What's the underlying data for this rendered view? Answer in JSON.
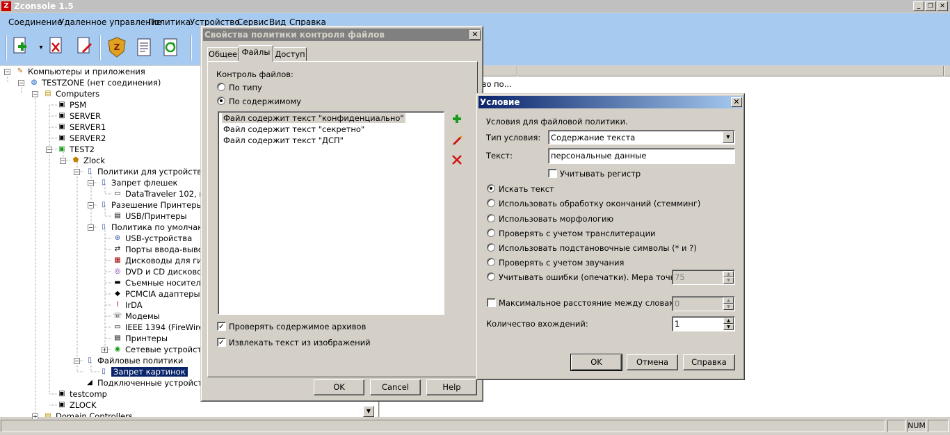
{
  "app": {
    "title": "Zconsole 1.5",
    "logo_letter": "Z"
  },
  "window_buttons": {
    "minimize": "_",
    "restore": "❐",
    "close": "✕"
  },
  "menu": [
    "Соединение",
    "Удаленное управление",
    "Политика",
    "Устройство",
    "Сервис",
    "Вид",
    "Справка"
  ],
  "tree": [
    {
      "label": "Компьютеры и приложения"
    },
    {
      "label": "TESTZONE (нет соединения)"
    },
    {
      "label": "Computers"
    },
    {
      "label": "PSM"
    },
    {
      "label": "SERVER"
    },
    {
      "label": "SERVER1"
    },
    {
      "label": "SERVER2"
    },
    {
      "label": "TEST2"
    },
    {
      "label": "Zlock"
    },
    {
      "label": "Политики для устройств"
    },
    {
      "label": "Запрет флешек"
    },
    {
      "label": "DataTraveler 102, про"
    },
    {
      "label": "Разешение Принтеры"
    },
    {
      "label": "USB/Принтеры"
    },
    {
      "label": "Политика по умолчанию"
    },
    {
      "label": "USB-устройства"
    },
    {
      "label": "Порты ввода-вывода"
    },
    {
      "label": "Дисководы для гибк"
    },
    {
      "label": "DVD и CD дисковод"
    },
    {
      "label": "Съемные носители"
    },
    {
      "label": "PCMCIA адаптеры"
    },
    {
      "label": "IrDA"
    },
    {
      "label": "Модемы"
    },
    {
      "label": "IEEE 1394 (FireWire)"
    },
    {
      "label": "Принтеры"
    },
    {
      "label": "Сетевые устройства"
    },
    {
      "label": "Файловые политики"
    },
    {
      "label": "Запрет картинок"
    },
    {
      "label": "Подключенные устройства"
    },
    {
      "label": "testcomp"
    },
    {
      "label": "ZLOCK"
    },
    {
      "label": "Domain Controllers"
    }
  ],
  "right_pane": {
    "row_text": "тво по..."
  },
  "file_policy_dialog": {
    "title": "Свойства политики контроля файлов",
    "tabs": [
      "Общее",
      "Файлы",
      "Доступ"
    ],
    "active_tab": "Файлы",
    "group_label": "Контроль файлов:",
    "radio_type": "По типу",
    "radio_content": "По содержимому",
    "selected_radio": "По содержимому",
    "conditions": [
      "Файл содержит текст \"конфиденциально\"",
      "Файл содержит текст \"секретно\"",
      "Файл содержит текст \"ДСП\""
    ],
    "check_archives": "Проверять содержимое архивов",
    "check_archives_checked": true,
    "check_images": "Извлекать текст из изображений",
    "check_images_checked": true,
    "ok": "OK",
    "cancel": "Cancel",
    "help": "Help",
    "icons": {
      "add": "plus-icon",
      "edit": "pencil-icon",
      "delete": "delete-icon"
    },
    "colors": {
      "add": "#1a9a1a",
      "delete": "#d01010"
    }
  },
  "condition_dialog": {
    "title": "Условие",
    "description": "Условия для файловой политики.",
    "type_label": "Тип условия:",
    "type_value": "Содержание текста",
    "text_label": "Текст:",
    "text_value": "персональные данные",
    "case_label": "Учитывать регистр",
    "case_checked": false,
    "options": [
      "Искать текст",
      "Использовать обработку окончаний (стемминг)",
      "Использовать морфологию",
      "Проверять с учетом транслитерации",
      "Использовать подстановочные символы (* и ?)",
      "Проверять с учетом звучания",
      "Учитывать ошибки (опечатки). Мера точности:"
    ],
    "selected_option": "Искать текст",
    "accuracy_value": "75",
    "max_distance_label": "Максимальное расстояние между словами:",
    "max_distance_checked": false,
    "max_distance_value": "0",
    "count_label": "Количество вхождений:",
    "count_value": "1",
    "ok": "OK",
    "cancel": "Отмена",
    "help": "Справка"
  },
  "statusbar": {
    "num": "NUM"
  },
  "colors": {
    "menubar": "#a6caf0",
    "dialog_title_active": "#0a246a",
    "dialog_title_inactive": "#808080",
    "selection": "#0a246a"
  }
}
